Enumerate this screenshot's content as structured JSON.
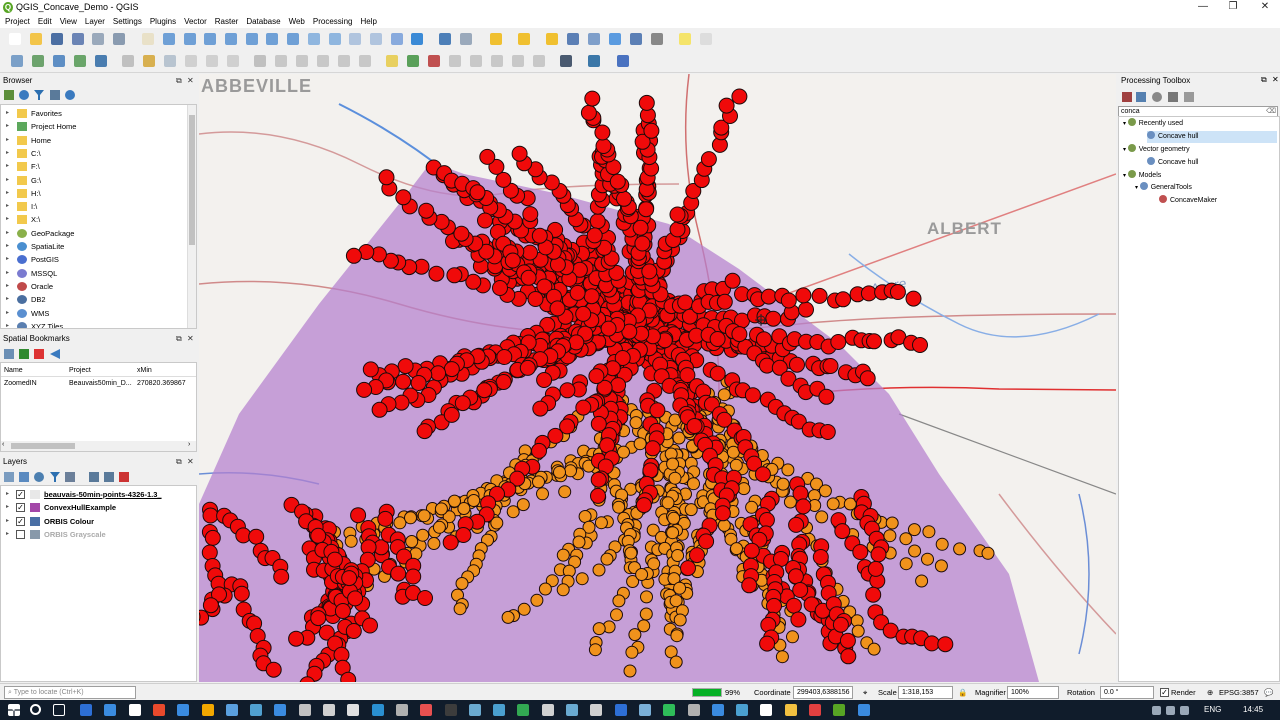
{
  "window": {
    "title": "QGIS_Concave_Demo - QGIS",
    "logo_letter": "Q",
    "minimize": "—",
    "maximize": "❐",
    "close": "✕"
  },
  "menu": [
    "Project",
    "Edit",
    "View",
    "Layer",
    "Settings",
    "Plugins",
    "Vector",
    "Raster",
    "Database",
    "Web",
    "Processing",
    "Help"
  ],
  "browser": {
    "title": "Browser",
    "items": [
      "Favorites",
      "Project Home",
      "Home",
      "C:\\",
      "F:\\",
      "G:\\",
      "H:\\",
      "I:\\",
      "X:\\",
      "GeoPackage",
      "SpatiaLite",
      "PostGIS",
      "MSSQL",
      "Oracle",
      "DB2",
      "WMS",
      "XYZ Tiles"
    ]
  },
  "bookmarks": {
    "title": "Spatial Bookmarks",
    "headers": [
      "Name",
      "Project",
      "xMin"
    ],
    "rows": [
      [
        "ZoomedIN",
        "Beauvais50min_D...",
        "270820.369867"
      ]
    ]
  },
  "layers": {
    "title": "Layers",
    "items": [
      {
        "name": "beauvais-50min-points-4326-1.3_",
        "checked": true,
        "color": "#e8e8e8",
        "muted": false,
        "underline": true
      },
      {
        "name": "ConvexHullExample",
        "checked": true,
        "color": "#a347a8",
        "muted": false,
        "underline": false
      },
      {
        "name": "ORBIS Colour",
        "checked": true,
        "color": "#4a6fa5",
        "muted": false,
        "underline": false
      },
      {
        "name": "ORBIS Grayscale",
        "checked": false,
        "color": "#8899aa",
        "muted": true,
        "underline": false
      }
    ]
  },
  "map": {
    "labels": [
      "ABBEVILLE",
      "ALBERT",
      "Ancre"
    ],
    "hull_color": "#b47fcf",
    "point_red": "#f00a0a",
    "point_orange": "#f0921c"
  },
  "toolbox": {
    "title": "Processing Toolbox",
    "search": "conca",
    "tree": [
      {
        "label": "Recently used",
        "level": 0
      },
      {
        "label": "Concave hull",
        "level": 2,
        "selected": true
      },
      {
        "label": "Vector geometry",
        "level": 0
      },
      {
        "label": "Concave hull",
        "level": 2
      },
      {
        "label": "Models",
        "level": 0
      },
      {
        "label": "GeneralTools",
        "level": 1
      },
      {
        "label": "ConcaveMaker",
        "level": 3
      }
    ]
  },
  "status": {
    "locator_placeholder": "Type to locate (Ctrl+K)",
    "progress_label": "99%",
    "progress": 0.99,
    "coordinate_label": "Coordinate",
    "coordinate": "299403,6388156",
    "scale_label": "Scale",
    "scale": "1:318,153",
    "magnifier_label": "Magnifier",
    "magnifier": "100%",
    "rotation_label": "Rotation",
    "rotation": "0.0 °",
    "render_label": "Render",
    "crs": "EPSG:3857"
  },
  "taskbar": {
    "lang": "ENG",
    "time": "14:45"
  }
}
